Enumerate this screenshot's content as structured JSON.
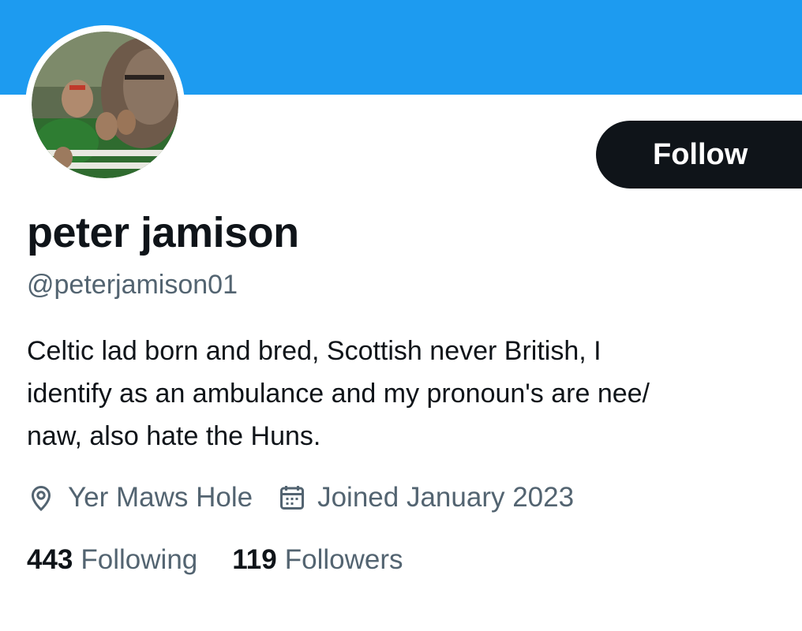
{
  "theme": {
    "banner_color": "#1d9bf0",
    "text_primary": "#0f1419",
    "text_secondary": "#536471",
    "button_bg": "#0f1419",
    "button_text": "#ffffff"
  },
  "profile": {
    "display_name": "peter jamison",
    "handle": "@peterjamison01",
    "bio_lines": [
      "Celtic lad born and bred, Scottish never British, I",
      "identify as an ambulance and my pronoun's are nee/",
      "naw, also hate the Huns."
    ],
    "location": "Yer Maws Hole",
    "location_icon": "location-pin-icon",
    "joined": "Joined January 2023",
    "joined_icon": "calendar-icon"
  },
  "actions": {
    "follow_label": "Follow"
  },
  "stats": {
    "following_count": "443",
    "following_label": "Following",
    "followers_count": "119",
    "followers_label": "Followers"
  }
}
